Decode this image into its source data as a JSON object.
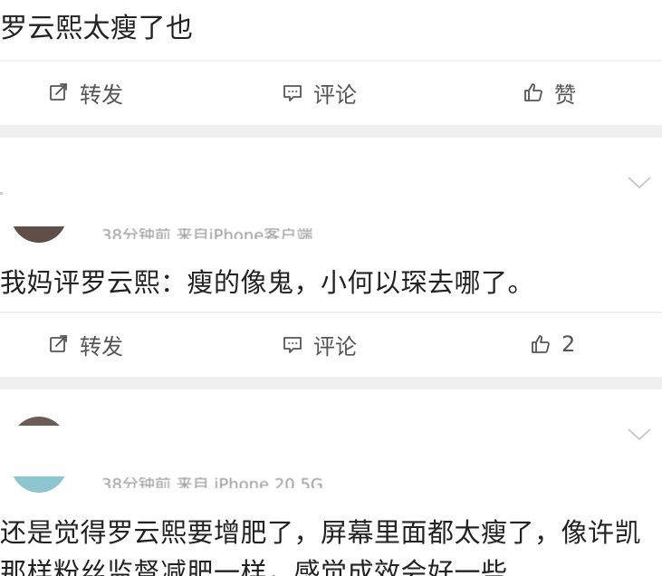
{
  "posts": [
    {
      "text": "罗云熙太瘦了也",
      "actions": {
        "repost_label": "转发",
        "comment_label": "评论",
        "like_label": "赞"
      }
    },
    {
      "meta": "38分钟前 来自iPhone客户端",
      "text": "我妈评罗云熙：瘦的像鬼，小何以琛去哪了。",
      "actions": {
        "repost_label": "转发",
        "comment_label": "评论",
        "like_label": "2"
      }
    },
    {
      "meta": "38分钟前 来自 iPhone 20 5G",
      "text": "还是觉得罗云熙要增肥了，屏幕里面都太瘦了，像许凯那样粉丝监督减肥一样，感觉成效会好一些"
    }
  ],
  "icons": {
    "repost": "repost-icon",
    "comment": "comment-icon",
    "like": "thumbs-up-icon",
    "menu": "chevron-down-icon"
  },
  "colors": {
    "text": "#222222",
    "action_text": "#555555",
    "separator": "#f0f0f0",
    "chevron": "#c2c2c2"
  }
}
